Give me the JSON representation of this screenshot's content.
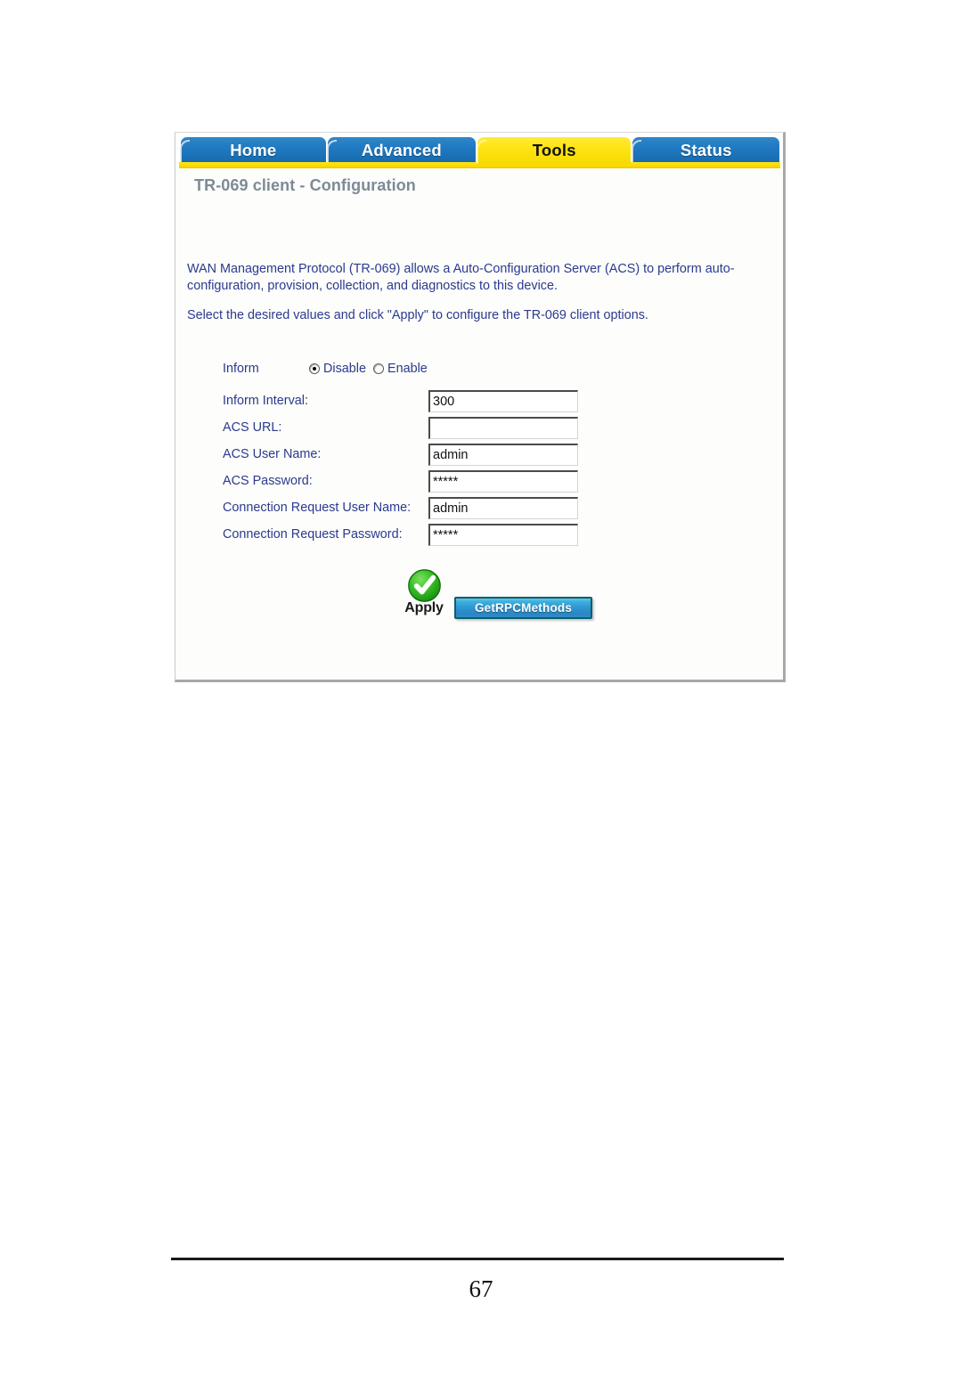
{
  "document": {
    "page_number": "67"
  },
  "panel": {
    "title": "TR-069 client - Configuration",
    "tabs": [
      {
        "label": "Home",
        "active": false
      },
      {
        "label": "Advanced",
        "active": false
      },
      {
        "label": "Tools",
        "active": true
      },
      {
        "label": "Status",
        "active": false
      }
    ],
    "descriptions": [
      "WAN Management Protocol (TR-069) allows a Auto-Configuration Server (ACS) to perform auto-configuration, provision, collection, and diagnostics to this device.",
      "Select the desired values and click \"Apply\" to configure the TR-069 client options."
    ],
    "form": {
      "inform": {
        "label": "Inform",
        "options": [
          {
            "label": "Disable",
            "checked": true
          },
          {
            "label": "Enable",
            "checked": false
          }
        ]
      },
      "fields": [
        {
          "label": "Inform Interval:",
          "value": "300",
          "placeholder": ""
        },
        {
          "label": "ACS URL:",
          "value": "",
          "placeholder": ""
        },
        {
          "label": "ACS User Name:",
          "value": "admin",
          "placeholder": ""
        },
        {
          "label": "ACS Password:",
          "value": "*****",
          "placeholder": ""
        },
        {
          "label": "Connection Request User Name:",
          "value": "admin",
          "placeholder": ""
        },
        {
          "label": "Connection Request Password:",
          "value": "*****",
          "placeholder": ""
        }
      ]
    },
    "buttons": {
      "apply_label": "Apply",
      "apply_icon": "green-check-icon",
      "getrpcmethods_label": "GetRPCMethods"
    }
  },
  "colors": {
    "tab_active_bg": "#ffe516",
    "tab_inactive_bg": "#1f79c0",
    "label_text": "#2b3a8f",
    "title_text": "#7e8a96",
    "apply_green": "#2fbd20",
    "button_blue": "#2e95cf"
  }
}
